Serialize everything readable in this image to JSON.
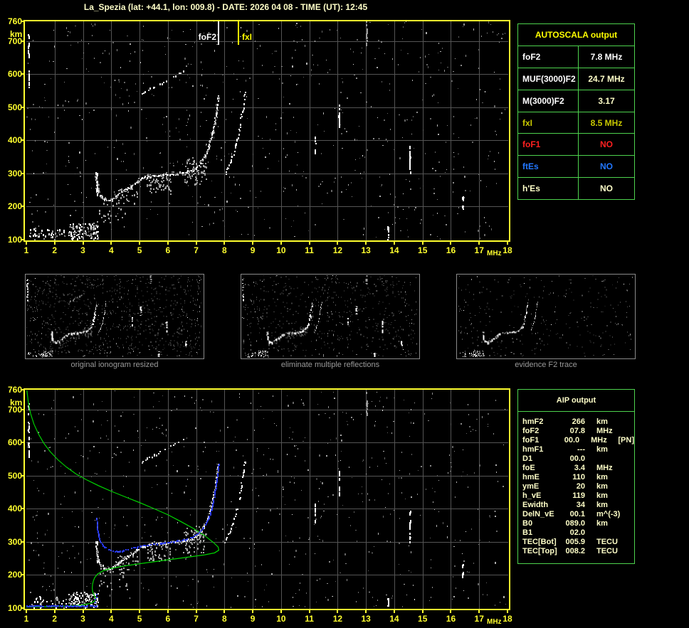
{
  "title": "La_Spezia (lat: +44.1, lon: 009.8) - DATE: 2026 04 08 - TIME (UT): 12:45",
  "colors": {
    "background": "#000000",
    "frame_yellow": "#ffff2e",
    "grid_gray": "#545454",
    "title_yellow": "#ffffc8",
    "table_border_green": "#4dd24d",
    "pale_yellow": "#ffffc8",
    "dark_yellow": "#c8c800",
    "red": "#ff2020",
    "blue": "#2277ff",
    "white": "#ffffff",
    "profile_green": "#00d200",
    "trace_blue": "#2738ee",
    "caption_gray": "#9a9a9a"
  },
  "top_plot": {
    "y_unit": "km",
    "y_ticks": [
      760,
      700,
      600,
      500,
      400,
      300,
      200,
      100
    ],
    "x_ticks": [
      1,
      2,
      3,
      4,
      5,
      6,
      7,
      8,
      9,
      10,
      11,
      12,
      13,
      14,
      15,
      16,
      17,
      18
    ],
    "x_unit": "MHz",
    "markers": {
      "foF2": {
        "label": "foF2",
        "mhz": 7.8,
        "color": "#ffffff"
      },
      "fxI": {
        "label": "fxI",
        "mhz": 8.5,
        "color": "#ffff00"
      }
    }
  },
  "bottom_plot": {
    "y_unit": "km",
    "y_ticks": [
      760,
      700,
      600,
      500,
      400,
      300,
      200,
      100
    ],
    "x_ticks": [
      1,
      2,
      3,
      4,
      5,
      6,
      7,
      8,
      9,
      10,
      11,
      12,
      13,
      14,
      15,
      16,
      17,
      18
    ],
    "x_unit": "MHz"
  },
  "autoscala_table": {
    "header": "AUTOSCALA output",
    "rows": [
      {
        "label": "foF2",
        "value": "7.8 MHz",
        "label_color": "#ffffff",
        "value_color": "#ffffff"
      },
      {
        "label": "MUF(3000)F2",
        "value": "24.7 MHz",
        "label_color": "#ffffff",
        "value_color": "#ffffc8"
      },
      {
        "label": "M(3000)F2",
        "value": "3.17",
        "label_color": "#ffffff",
        "value_color": "#ffffc8"
      },
      {
        "label": "fxI",
        "value": "8.5 MHz",
        "label_color": "#c8c800",
        "value_color": "#c8c800"
      },
      {
        "label": "foF1",
        "value": "NO",
        "label_color": "#ff2020",
        "value_color": "#ff2020"
      },
      {
        "label": "ftEs",
        "value": "NO",
        "label_color": "#2277ff",
        "value_color": "#2277ff"
      },
      {
        "label": "h'Es",
        "value": "NO",
        "label_color": "#ffffc8",
        "value_color": "#ffffc8"
      }
    ]
  },
  "thumbnails": [
    {
      "caption": "original ionogram resized"
    },
    {
      "caption": "eliminate multiple reflections"
    },
    {
      "caption": "evidence F2 trace"
    }
  ],
  "aip_table": {
    "header": "AIP output",
    "rows": [
      {
        "param": "hmF2",
        "value": "266",
        "unit": "km",
        "extra": ""
      },
      {
        "param": "foF2",
        "value": "07.8",
        "unit": "MHz",
        "extra": ""
      },
      {
        "param": "foF1",
        "value": "00.0",
        "unit": "MHz",
        "extra": "[PN]"
      },
      {
        "param": "hmF1",
        "value": "---",
        "unit": "km",
        "extra": ""
      },
      {
        "param": "D1",
        "value": "00.0",
        "unit": "",
        "extra": ""
      },
      {
        "param": "foE",
        "value": "3.4",
        "unit": "MHz",
        "extra": ""
      },
      {
        "param": "hmE",
        "value": "110",
        "unit": "km",
        "extra": ""
      },
      {
        "param": "ymE",
        "value": "20",
        "unit": "km",
        "extra": ""
      },
      {
        "param": "h_vE",
        "value": "119",
        "unit": "km",
        "extra": ""
      },
      {
        "param": "Ewidth",
        "value": "34",
        "unit": "km",
        "extra": ""
      },
      {
        "param": "DelN_vE",
        "value": "00.1",
        "unit": "m^(-3)",
        "extra": ""
      },
      {
        "param": "B0",
        "value": "089.0",
        "unit": "km",
        "extra": ""
      },
      {
        "param": "B1",
        "value": "02.0",
        "unit": "",
        "extra": ""
      },
      {
        "param": "TEC[Bot]",
        "value": "005.9",
        "unit": "TECU",
        "extra": ""
      },
      {
        "param": "TEC[Top]",
        "value": "008.2",
        "unit": "TECU",
        "extra": ""
      }
    ]
  },
  "chart_data": {
    "type": "scatter",
    "xlabel": "MHz",
    "ylabel": "km",
    "xlim": [
      1,
      18
    ],
    "ylim": [
      100,
      760
    ],
    "grid": true,
    "autoscala_values": {
      "foF2_MHz": 7.8,
      "fxI_MHz": 8.5,
      "MUF3000F2_MHz": 24.7,
      "M3000F2": 3.17
    },
    "noise_dots": 620,
    "o_trace": [
      [
        3.44,
        302
      ],
      [
        3.47,
        282
      ],
      [
        3.5,
        262
      ],
      [
        3.54,
        246
      ],
      [
        3.6,
        234
      ],
      [
        3.68,
        227
      ],
      [
        3.78,
        222
      ],
      [
        3.9,
        219
      ],
      [
        4.02,
        221
      ],
      [
        4.15,
        230
      ],
      [
        4.3,
        240
      ],
      [
        4.5,
        251
      ],
      [
        4.7,
        262
      ],
      [
        4.9,
        275
      ],
      [
        5.1,
        287
      ],
      [
        5.35,
        292
      ],
      [
        5.6,
        295
      ],
      [
        5.85,
        297
      ],
      [
        6.1,
        299
      ],
      [
        6.35,
        301
      ],
      [
        6.6,
        304
      ],
      [
        6.85,
        309
      ],
      [
        7.0,
        317
      ],
      [
        7.15,
        330
      ],
      [
        7.28,
        348
      ],
      [
        7.4,
        370
      ],
      [
        7.5,
        398
      ],
      [
        7.58,
        426
      ],
      [
        7.65,
        455
      ],
      [
        7.7,
        482
      ],
      [
        7.74,
        508
      ],
      [
        7.77,
        535
      ]
    ],
    "x_trace": [
      [
        8.02,
        300
      ],
      [
        8.1,
        315
      ],
      [
        8.2,
        334
      ],
      [
        8.3,
        357
      ],
      [
        8.4,
        385
      ],
      [
        8.48,
        415
      ],
      [
        8.55,
        448
      ],
      [
        8.61,
        480
      ],
      [
        8.67,
        512
      ],
      [
        8.72,
        545
      ]
    ],
    "second_hop": [
      [
        5.08,
        542
      ],
      [
        5.28,
        552
      ],
      [
        5.5,
        562
      ],
      [
        5.72,
        572
      ],
      [
        5.95,
        582
      ],
      [
        6.18,
        592
      ],
      [
        6.38,
        601
      ],
      [
        6.55,
        610
      ]
    ],
    "e_clusters": [
      {
        "x": [
          2.5,
          3.55
        ],
        "y": [
          102,
          150
        ],
        "n": 120
      },
      {
        "x": [
          1.05,
          2.5
        ],
        "y": [
          100,
          135
        ],
        "n": 40
      }
    ],
    "patches": [
      {
        "x": [
          5.25,
          6.1
        ],
        "y": [
          242,
          300
        ],
        "n": 60
      },
      {
        "x": [
          6.55,
          7.35
        ],
        "y": [
          268,
          350
        ],
        "n": 70
      },
      {
        "x": [
          4.15,
          4.95
        ],
        "y": [
          208,
          258
        ],
        "n": 28
      },
      {
        "x": [
          3.55,
          4.6
        ],
        "y": [
          150,
          215
        ],
        "n": 22
      }
    ],
    "interference_columns": [
      {
        "x": 1.08,
        "y": [
          555,
          725
        ],
        "n": 18
      },
      {
        "x": 12.05,
        "y": [
          438,
          515
        ],
        "n": 12
      },
      {
        "x": 14.55,
        "y": [
          298,
          398
        ],
        "n": 14
      },
      {
        "x": 16.42,
        "y": [
          186,
          232
        ],
        "n": 8
      },
      {
        "x": 13.78,
        "y": [
          100,
          142
        ],
        "n": 8
      },
      {
        "x": 13.02,
        "y": [
          690,
          760
        ],
        "n": 10,
        "c": "#999999"
      },
      {
        "x": 11.2,
        "y": [
          350,
          420
        ],
        "n": 6
      }
    ],
    "cusp_column": {
      "x": 3.49,
      "y": [
        235,
        302
      ],
      "n": 10
    },
    "profile_green": [
      [
        1.02,
        758
      ],
      [
        1.07,
        722
      ],
      [
        1.15,
        688
      ],
      [
        1.27,
        656
      ],
      [
        1.43,
        626
      ],
      [
        1.62,
        598
      ],
      [
        1.85,
        572
      ],
      [
        2.12,
        548
      ],
      [
        2.42,
        526
      ],
      [
        2.75,
        506
      ],
      [
        3.12,
        488
      ],
      [
        3.55,
        470
      ],
      [
        4.0,
        453
      ],
      [
        4.5,
        436
      ],
      [
        5.0,
        419
      ],
      [
        5.5,
        401
      ],
      [
        6.0,
        382
      ],
      [
        6.45,
        362
      ],
      [
        6.9,
        341
      ],
      [
        7.3,
        319
      ],
      [
        7.6,
        299
      ],
      [
        7.78,
        284
      ],
      [
        7.8,
        275
      ],
      [
        7.65,
        267
      ],
      [
        7.3,
        261
      ],
      [
        6.8,
        255
      ],
      [
        6.2,
        248
      ],
      [
        5.6,
        241
      ],
      [
        5.0,
        234
      ],
      [
        4.45,
        227
      ],
      [
        4.0,
        220
      ],
      [
        3.7,
        212
      ],
      [
        3.52,
        203
      ],
      [
        3.42,
        193
      ],
      [
        3.37,
        183
      ],
      [
        3.34,
        172
      ],
      [
        3.33,
        161
      ],
      [
        3.34,
        151
      ],
      [
        3.37,
        143
      ],
      [
        3.41,
        136
      ],
      [
        3.44,
        129
      ],
      [
        3.42,
        122
      ],
      [
        3.33,
        117
      ],
      [
        3.2,
        113
      ],
      [
        3.0,
        110
      ],
      [
        2.75,
        108
      ],
      [
        2.45,
        106
      ],
      [
        2.1,
        105
      ],
      [
        1.7,
        104
      ],
      [
        1.3,
        104
      ],
      [
        1.0,
        103
      ]
    ],
    "restored_trace_blue": [
      [
        3.47,
        378
      ],
      [
        3.49,
        356
      ],
      [
        3.51,
        339
      ],
      [
        3.54,
        324
      ],
      [
        3.58,
        310
      ],
      [
        3.63,
        299
      ],
      [
        3.7,
        290
      ],
      [
        3.8,
        283
      ],
      [
        3.92,
        277
      ],
      [
        4.05,
        273
      ],
      [
        4.2,
        272
      ],
      [
        4.38,
        274
      ],
      [
        4.58,
        278
      ],
      [
        4.78,
        283
      ],
      [
        5.0,
        287
      ],
      [
        5.25,
        291
      ],
      [
        5.5,
        294
      ],
      [
        5.78,
        297
      ],
      [
        6.05,
        300
      ],
      [
        6.3,
        303
      ],
      [
        6.55,
        307
      ],
      [
        6.8,
        313
      ],
      [
        7.0,
        322
      ],
      [
        7.18,
        335
      ],
      [
        7.32,
        352
      ],
      [
        7.44,
        374
      ],
      [
        7.54,
        400
      ],
      [
        7.62,
        428
      ],
      [
        7.68,
        458
      ],
      [
        7.73,
        488
      ],
      [
        7.77,
        520
      ],
      [
        7.79,
        536
      ]
    ],
    "restored_e_blue": {
      "x_from": 1.0,
      "x_to": 3.52,
      "km": 106,
      "blip": [
        [
          3.44,
          116
        ],
        [
          3.46,
          124
        ],
        [
          3.49,
          132
        ],
        [
          3.51,
          140
        ]
      ]
    }
  }
}
